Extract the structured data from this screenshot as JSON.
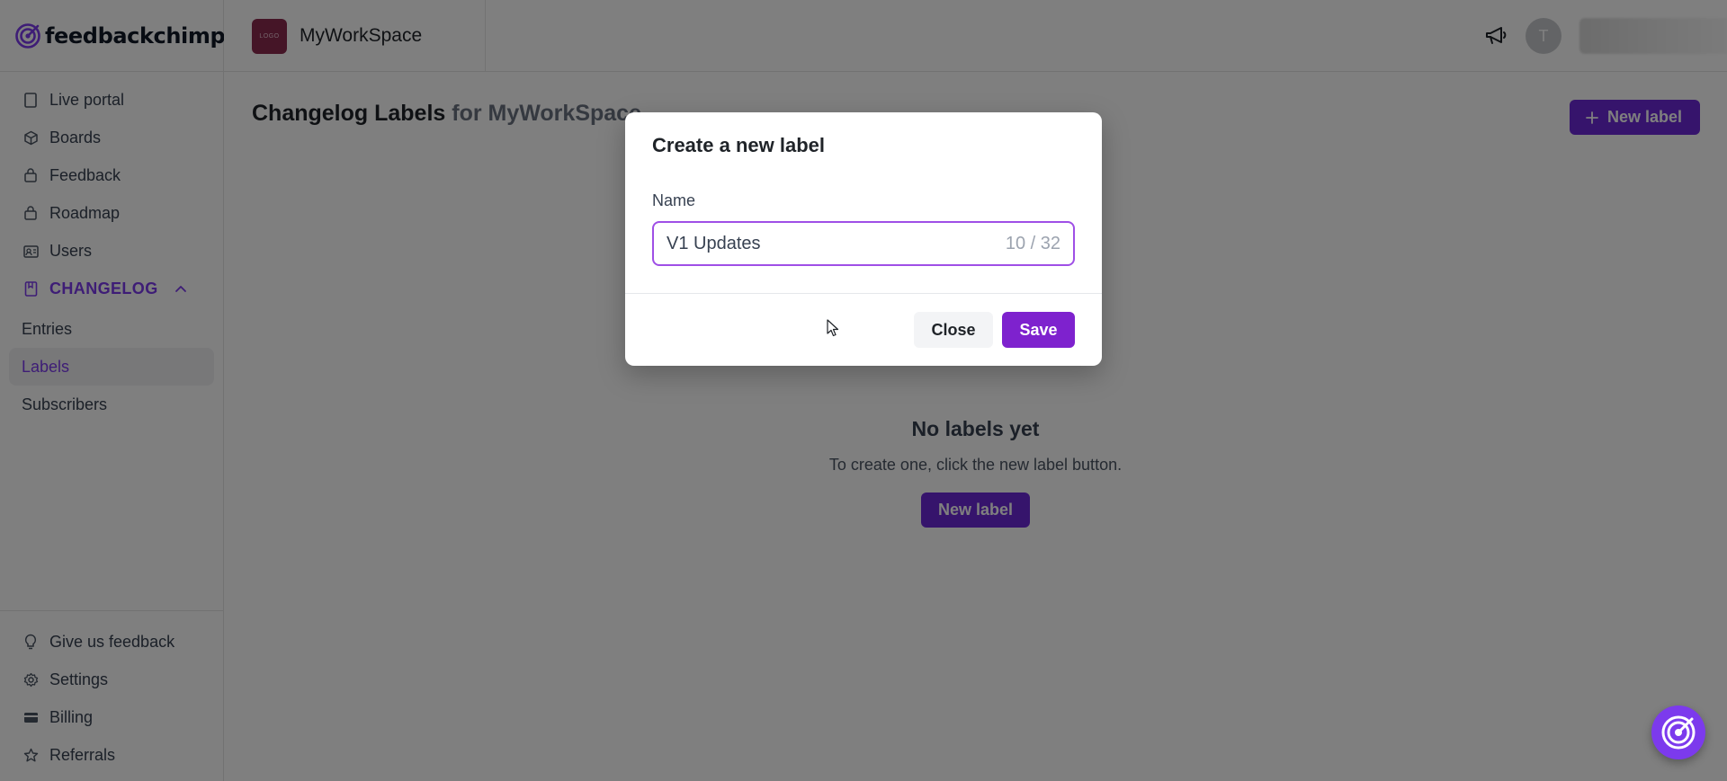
{
  "brand": {
    "name": "feedbackchimp",
    "logo_icon": "target-icon"
  },
  "workspace": {
    "logo_text": "LOGO",
    "name": "MyWorkSpace"
  },
  "topbar": {
    "announce_icon": "megaphone-icon",
    "avatar_initial": "T"
  },
  "sidebar": {
    "items": [
      {
        "label": "Live portal",
        "icon": "page-icon"
      },
      {
        "label": "Boards",
        "icon": "box-icon"
      },
      {
        "label": "Feedback",
        "icon": "lock-box-icon"
      },
      {
        "label": "Roadmap",
        "icon": "lock-box-icon"
      },
      {
        "label": "Users",
        "icon": "id-card-icon"
      }
    ],
    "section": {
      "label": "CHANGELOG",
      "icon": "bookmark-icon"
    },
    "subitems": [
      {
        "label": "Entries"
      },
      {
        "label": "Labels",
        "active": true
      },
      {
        "label": "Subscribers"
      }
    ],
    "bottom": [
      {
        "label": "Give us feedback",
        "icon": "bulb-icon"
      },
      {
        "label": "Settings",
        "icon": "gear-icon"
      },
      {
        "label": "Billing",
        "icon": "card-icon"
      },
      {
        "label": "Referrals",
        "icon": "star-icon"
      }
    ]
  },
  "main": {
    "title": "Changelog Labels",
    "title_suffix": "for MyWorkSpace",
    "new_label_button": "New label",
    "empty_title": "No labels yet",
    "empty_subtitle": "To create one, click the new label button.",
    "empty_button": "New label"
  },
  "modal": {
    "title": "Create a new label",
    "field_label": "Name",
    "input_value": "V1 Updates",
    "counter": "10 / 32",
    "close_label": "Close",
    "save_label": "Save"
  },
  "colors": {
    "accent": "#7c3aed",
    "button_primary": "#6d28d9",
    "overlay": "rgba(0,0,0,0.5)"
  }
}
